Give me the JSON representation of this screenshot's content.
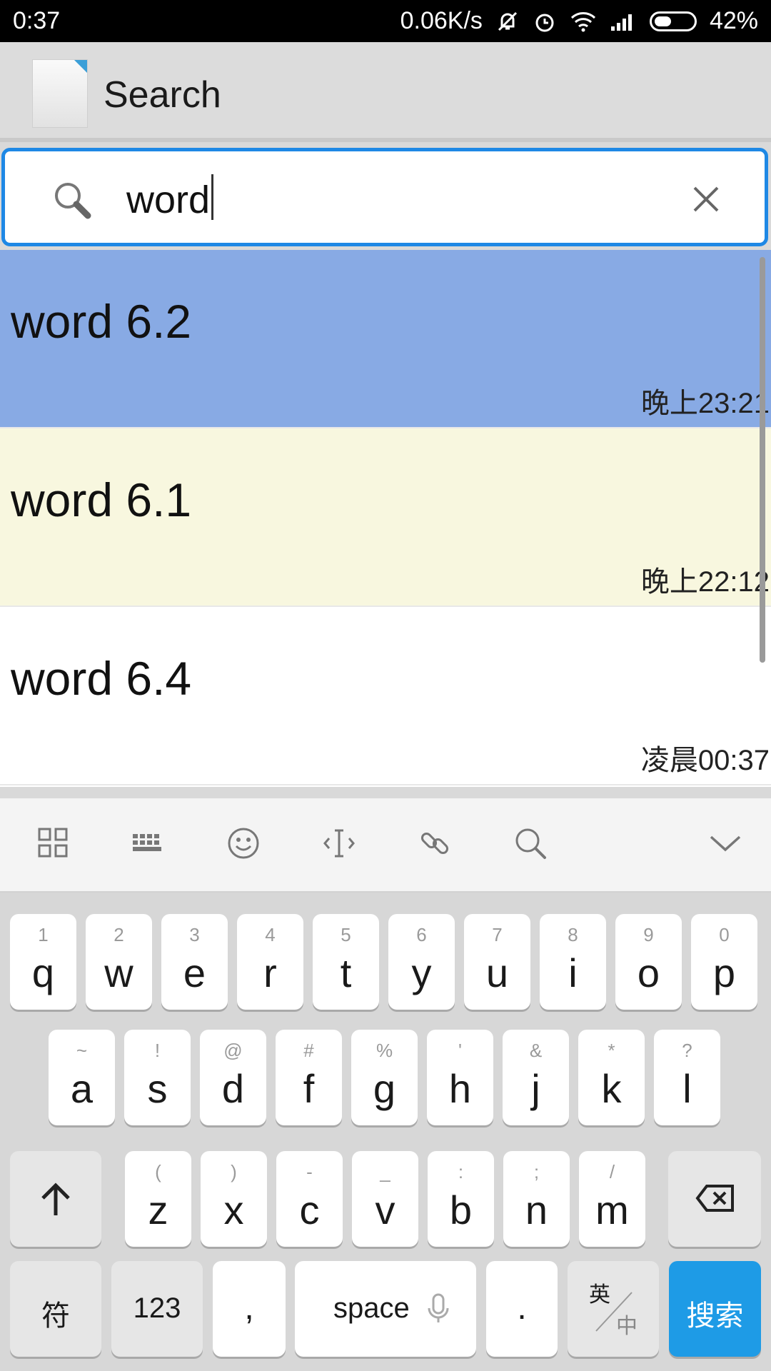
{
  "status_bar": {
    "time": "0:37",
    "net_speed": "0.06K/s",
    "battery": "42%",
    "battery_level": 0.42
  },
  "app_bar": {
    "title": "Search"
  },
  "search": {
    "query": "word"
  },
  "results": [
    {
      "name": "word 6.2",
      "time": "晚上23:21",
      "color": "#88aae4"
    },
    {
      "name": "word 6.1",
      "time": "晚上22:12",
      "color": "#f8f7df"
    },
    {
      "name": "word 6.4",
      "time": "凌晨00:37",
      "color": "#ffffff"
    }
  ],
  "keyboard": {
    "toolbar_icons": [
      "grid-icon",
      "keyboard-icon",
      "emoji-icon",
      "cursor-icon",
      "link-icon",
      "search-icon",
      "collapse-chevron-icon"
    ],
    "row1": [
      {
        "k": "q",
        "s": "1"
      },
      {
        "k": "w",
        "s": "2"
      },
      {
        "k": "e",
        "s": "3"
      },
      {
        "k": "r",
        "s": "4"
      },
      {
        "k": "t",
        "s": "5"
      },
      {
        "k": "y",
        "s": "6"
      },
      {
        "k": "u",
        "s": "7"
      },
      {
        "k": "i",
        "s": "8"
      },
      {
        "k": "o",
        "s": "9"
      },
      {
        "k": "p",
        "s": "0"
      }
    ],
    "row2": [
      {
        "k": "a",
        "s": "~"
      },
      {
        "k": "s",
        "s": "!"
      },
      {
        "k": "d",
        "s": "@"
      },
      {
        "k": "f",
        "s": "#"
      },
      {
        "k": "g",
        "s": "%"
      },
      {
        "k": "h",
        "s": "'"
      },
      {
        "k": "j",
        "s": "&"
      },
      {
        "k": "k",
        "s": "*"
      },
      {
        "k": "l",
        "s": "?"
      }
    ],
    "row3": [
      {
        "k": "z",
        "s": "("
      },
      {
        "k": "x",
        "s": ")"
      },
      {
        "k": "c",
        "s": "-"
      },
      {
        "k": "v",
        "s": "_"
      },
      {
        "k": "b",
        "s": ":"
      },
      {
        "k": "n",
        "s": ";"
      },
      {
        "k": "m",
        "s": "/"
      }
    ],
    "symbols_label": "符",
    "numbers_label": "123",
    "comma_label": ",",
    "space_label": "space",
    "period_label": ".",
    "lang_top": "英",
    "lang_bottom": "中",
    "enter_label": "搜索",
    "enter_color": "#1e9be6"
  }
}
